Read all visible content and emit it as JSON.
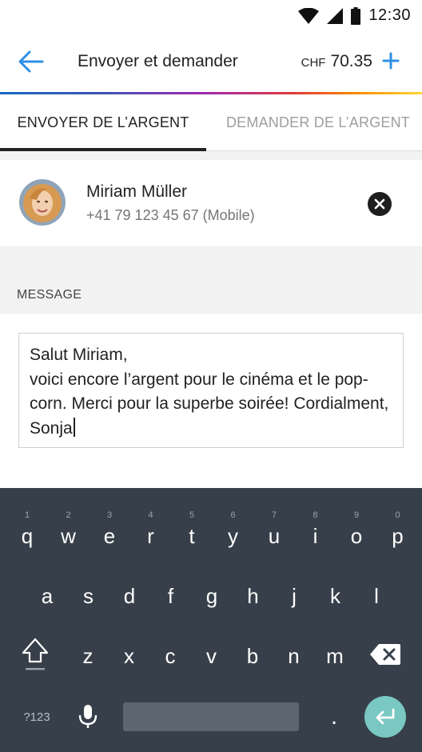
{
  "status_bar": {
    "time": "12:30"
  },
  "header": {
    "title": "Envoyer et demander",
    "currency": "CHF",
    "balance": "70.35"
  },
  "tabs": [
    {
      "label": "ENVOYER DE L’ARGENT",
      "active": true
    },
    {
      "label": "DEMANDER DE L’ARGENT",
      "active": false
    }
  ],
  "recipient": {
    "name": "Miriam Müller",
    "phone": "+41 79 123 45 67 (Mobile)"
  },
  "message": {
    "label": "MESSAGE",
    "text": "Salut Miriam,\nvoici encore l’argent pour le cinéma et le pop-corn. Merci pour la superbe soirée! Cordialment, Sonja"
  },
  "keyboard": {
    "row1": [
      {
        "key": "q",
        "hint": "1"
      },
      {
        "key": "w",
        "hint": "2"
      },
      {
        "key": "e",
        "hint": "3"
      },
      {
        "key": "r",
        "hint": "4"
      },
      {
        "key": "t",
        "hint": "5"
      },
      {
        "key": "y",
        "hint": "6"
      },
      {
        "key": "u",
        "hint": "7"
      },
      {
        "key": "i",
        "hint": "8"
      },
      {
        "key": "o",
        "hint": "9"
      },
      {
        "key": "p",
        "hint": "0"
      }
    ],
    "row2": [
      "a",
      "s",
      "d",
      "f",
      "g",
      "h",
      "j",
      "k",
      "l"
    ],
    "row3": [
      "z",
      "x",
      "c",
      "v",
      "b",
      "n",
      "m"
    ],
    "symbols_label": "?123",
    "period": "."
  },
  "colors": {
    "accent": "#2f8fe6",
    "keyboard_bg": "#37404a",
    "enter_key": "#79c8c2"
  }
}
